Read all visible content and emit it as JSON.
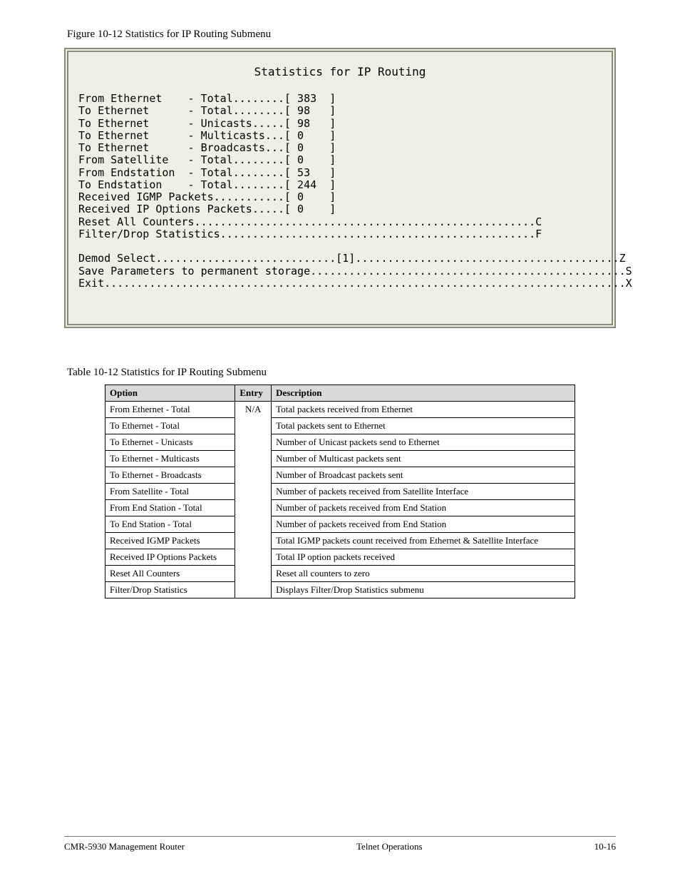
{
  "caption": "Figure 10-12  Statistics for IP Routing Submenu",
  "windowTitle": "Statistics for IP Routing",
  "terminal": [
    "From Ethernet    - Total........[ 383  ]",
    "To Ethernet      - Total........[ 98   ]",
    "To Ethernet      - Unicasts.....[ 98   ]",
    "To Ethernet      - Multicasts...[ 0    ]",
    "To Ethernet      - Broadcasts...[ 0    ]",
    "From Satellite   - Total........[ 0    ]",
    "From Endstation  - Total........[ 53   ]",
    "To Endstation    - Total........[ 244  ]",
    "Received IGMP Packets...........[ 0    ]",
    "Received IP Options Packets.....[ 0    ]",
    "Reset All Counters.....................................................C",
    "Filter/Drop Statistics.................................................F",
    "",
    "Demod Select............................[1].........................................Z",
    "Save Parameters to permanent storage.................................................S",
    "Exit.................................................................................X"
  ],
  "tableCaption": "Table 10-12  Statistics for IP Routing Submenu",
  "headers": {
    "option": "Option",
    "entry": "Entry",
    "description": "Description"
  },
  "rows": [
    {
      "option": "From Ethernet - Total",
      "entry": "N/A",
      "desc": "Total packets received from Ethernet"
    },
    {
      "option": "To Ethernet - Total",
      "entry": "",
      "desc": "Total packets sent to Ethernet"
    },
    {
      "option": "To Ethernet - Unicasts",
      "entry": "",
      "desc": "Number of Unicast packets send to Ethernet"
    },
    {
      "option": "To Ethernet - Multicasts",
      "entry": "",
      "desc": "Number of Multicast packets sent"
    },
    {
      "option": "To Ethernet - Broadcasts",
      "entry": "",
      "desc": "Number of Broadcast packets sent"
    },
    {
      "option": "From Satellite - Total",
      "entry": "",
      "desc": "Number of packets received from Satellite Interface"
    },
    {
      "option": "From End Station - Total",
      "entry": "",
      "desc": "Number of packets received from End Station"
    },
    {
      "option": "To End Station - Total",
      "entry": "",
      "desc": "Number of packets received from End Station"
    },
    {
      "option": "Received IGMP Packets",
      "entry": "",
      "desc": "Total IGMP packets count received from Ethernet & Satellite Interface"
    },
    {
      "option": "Received IP Options Packets",
      "entry": "",
      "desc": "Total IP option packets received"
    },
    {
      "option": "Reset All Counters",
      "entry": "",
      "desc": "Reset all counters to zero"
    },
    {
      "option": "Filter/Drop Statistics",
      "entry": "",
      "desc": "Displays Filter/Drop Statistics submenu"
    }
  ],
  "footer": {
    "left": "CMR-5930 Management Router",
    "center": "Telnet Operations",
    "right": "10-16"
  }
}
